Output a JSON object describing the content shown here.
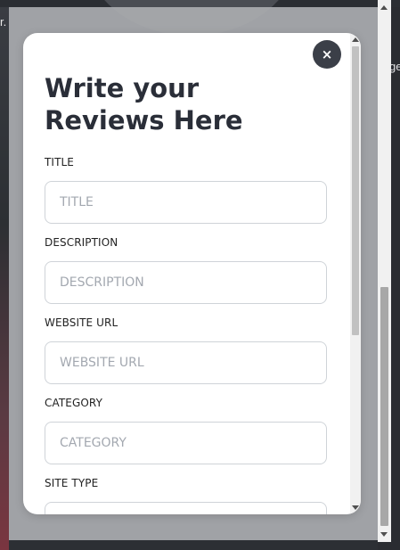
{
  "background": {
    "left_text": "r.",
    "right_text": "ge"
  },
  "modal": {
    "close_icon": "×",
    "title": "Write your Reviews Here",
    "fields": [
      {
        "label": "TITLE",
        "placeholder": "TITLE",
        "value": ""
      },
      {
        "label": "DESCRIPTION",
        "placeholder": "DESCRIPTION",
        "value": ""
      },
      {
        "label": "WEBSITE URL",
        "placeholder": "WEBSITE URL",
        "value": ""
      },
      {
        "label": "CATEGORY",
        "placeholder": "CATEGORY",
        "value": ""
      },
      {
        "label": "SITE TYPE",
        "placeholder": "",
        "value": ""
      }
    ]
  },
  "colors": {
    "title_text": "#2a2e38",
    "close_button_bg": "#3b3f48",
    "input_border": "#cfd3d8",
    "placeholder_text": "#a3a8b0",
    "overlay": "#aaacb0"
  },
  "icons": {
    "close": "close-icon",
    "scroll_up": "chevron-up-icon",
    "scroll_down": "chevron-down-icon"
  }
}
